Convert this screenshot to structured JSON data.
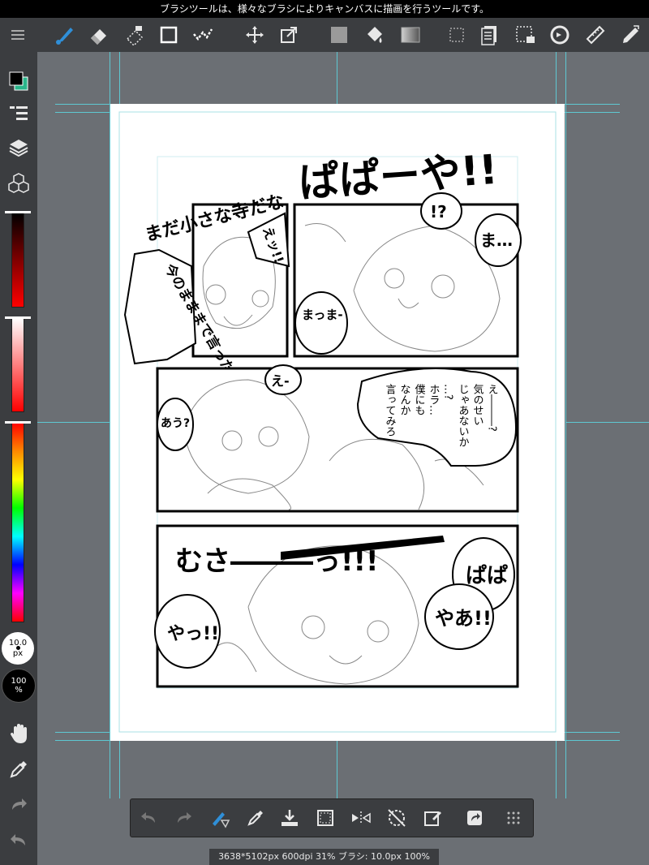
{
  "tooltip": "ブラシツールは、様々なブラシによりキャンバスに描画を行うツールです。",
  "toolbar": {
    "tools": [
      "menu-icon",
      "brush-icon",
      "eraser-icon",
      "fill-eraser-icon",
      "rectangle-icon",
      "snap-icon",
      "move-icon",
      "transform-icon",
      "fill-color-icon",
      "bucket-icon",
      "gradient-icon",
      "selection-icon",
      "layer-panel-icon",
      "select-all-icon",
      "rotate-icon",
      "ruler-icon",
      "magic-pen-icon"
    ]
  },
  "sidebar": {
    "brush_size": "10.0",
    "brush_size_unit": "px",
    "opacity": "100",
    "opacity_unit": "%"
  },
  "canvas": {
    "title_text": "ぱぱーや!!",
    "panel1_left_text": "まだ小さな寺だな",
    "panel1_left_sub": "えッ!!",
    "panel1_shout": "今のまままで言ったら!!",
    "panel1_bubble1": "!?",
    "panel1_bubble2": "ま…",
    "panel1_bubble3": "まっま-",
    "panel2_bubble1": "え-",
    "panel2_bubble2": "あう?",
    "panel2_text_right": "え―――?",
    "panel2_vertical_1": "気のせい",
    "panel2_vertical_2": "じゃあないか",
    "panel2_vertical_3": "…?",
    "panel2_vertical_4": "ホラ…",
    "panel2_vertical_5": "僕にも",
    "panel2_vertical_6": "なんか",
    "panel2_vertical_7": "言ってみろ",
    "panel3_shout": "むさ―――っ!!!",
    "panel3_bubble1": "ぱぱ",
    "panel3_bubble2": "やあ!!",
    "panel3_bubble3": "やっ!!"
  },
  "bottom_bar": {
    "buttons": [
      "undo-icon",
      "redo-icon",
      "brush-tool-icon",
      "eyedropper-icon",
      "save-icon",
      "select-icon",
      "flip-icon",
      "rotate-reset-icon",
      "edit-icon",
      "share-icon",
      "more-icon"
    ]
  },
  "status": "3638*5102px 600dpi 31% ブラシ: 10.0px 100%",
  "colors": {
    "primary": "#000000",
    "secondary": "#2ab58a",
    "accent": "#2f8fd8",
    "guide": "#5ec8d2"
  }
}
